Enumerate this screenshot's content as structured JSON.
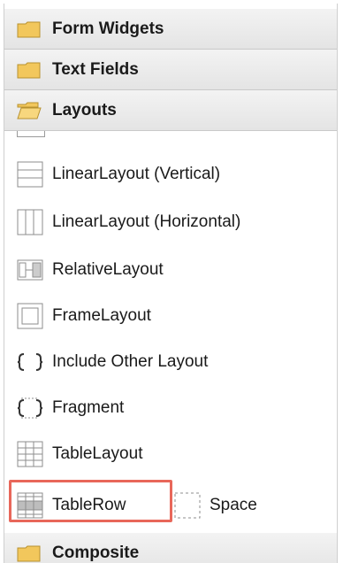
{
  "categories": {
    "form_widgets": "Form Widgets",
    "text_fields": "Text Fields",
    "layouts": "Layouts",
    "composite": "Composite"
  },
  "layout_items": [
    {
      "label": "LinearLayout (Vertical)",
      "icon": "linear-layout-vertical-icon"
    },
    {
      "label": "LinearLayout (Horizontal)",
      "icon": "linear-layout-horizontal-icon"
    },
    {
      "label": "RelativeLayout",
      "icon": "relative-layout-icon"
    },
    {
      "label": "FrameLayout",
      "icon": "frame-layout-icon"
    },
    {
      "label": "Include Other Layout",
      "icon": "include-layout-icon"
    },
    {
      "label": "Fragment",
      "icon": "fragment-icon"
    },
    {
      "label": "TableLayout",
      "icon": "table-layout-icon"
    },
    {
      "label": "TableRow",
      "icon": "table-row-icon"
    },
    {
      "label": "Space",
      "icon": "space-icon"
    }
  ],
  "colors": {
    "highlight": "#e8675a",
    "folder": "#f2c75c"
  }
}
